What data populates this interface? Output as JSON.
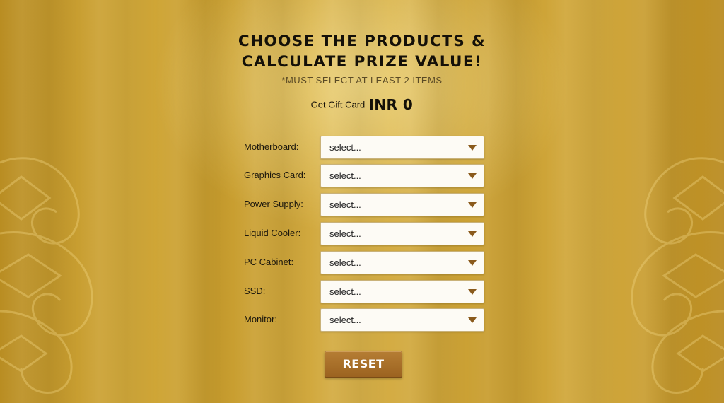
{
  "header": {
    "title_line1": "CHOOSE THE PRODUCTS &",
    "title_line2": "CALCULATE PRIZE VALUE!",
    "note": "*MUST SELECT AT LEAST 2 ITEMS"
  },
  "gift_card": {
    "label": "Get Gift Card",
    "amount": "INR 0"
  },
  "form": {
    "rows": [
      {
        "label": "Motherboard:",
        "value": "select..."
      },
      {
        "label": "Graphics Card:",
        "value": "select..."
      },
      {
        "label": "Power Supply:",
        "value": "select..."
      },
      {
        "label": "Liquid Cooler:",
        "value": "select..."
      },
      {
        "label": "PC Cabinet:",
        "value": "select..."
      },
      {
        "label": "SSD:",
        "value": "select..."
      },
      {
        "label": "Monitor:",
        "value": "select..."
      }
    ]
  },
  "actions": {
    "reset_label": "RESET"
  },
  "icons": {
    "dropdown": "chevron-down-icon",
    "ornament": "arabesque-ornament"
  },
  "colors": {
    "background_gold": "#d2a93a",
    "button_brown": "#a96f28",
    "arrow_brown": "#8a5a1c",
    "text_dark": "#141008"
  }
}
